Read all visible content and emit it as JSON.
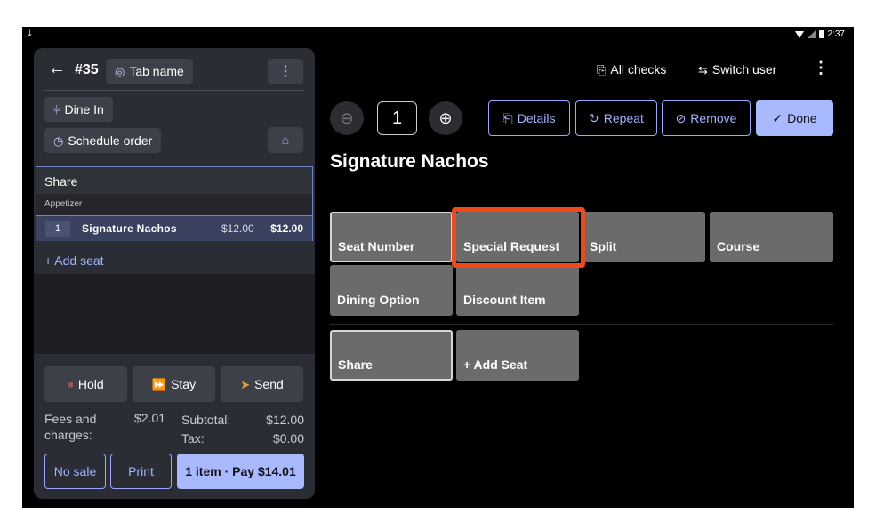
{
  "status": {
    "time": "2:37"
  },
  "panel": {
    "back_icon": "arrow-left-icon",
    "tab_number": "#35",
    "tab_name": "Tab name",
    "dine_in": "Dine In",
    "schedule": "Schedule order",
    "order_group": "Share",
    "category": "Appetizer",
    "item": {
      "qty": "1",
      "name": "Signature Nachos",
      "price": "$12.00",
      "total": "$12.00"
    },
    "add_seat": "+ Add seat",
    "hold": "Hold",
    "stay": "Stay",
    "send": "Send",
    "fees_label": "Fees and charges:",
    "fees_value": "$2.01",
    "subtotal_label": "Subtotal:",
    "subtotal_value": "$12.00",
    "tax_label": "Tax:",
    "tax_value": "$0.00",
    "no_sale": "No sale",
    "print": "Print",
    "pay": "1 item · Pay $14.01"
  },
  "topbar": {
    "all_checks": "All checks",
    "switch_user": "Switch user"
  },
  "editor": {
    "qty": "1",
    "details": "Details",
    "repeat": "Repeat",
    "remove": "Remove",
    "done": "Done",
    "item_title": "Signature Nachos",
    "tiles": {
      "seat_number": "Seat Number",
      "special_request": "Special Request",
      "split": "Split",
      "course": "Course",
      "dining_option": "Dining Option",
      "discount_item": "Discount Item",
      "share": "Share",
      "add_seat": "+ Add Seat"
    }
  },
  "colors": {
    "accent": "#a9b9ff",
    "highlight": "#f04a1a",
    "tile": "#6b6b6b"
  }
}
